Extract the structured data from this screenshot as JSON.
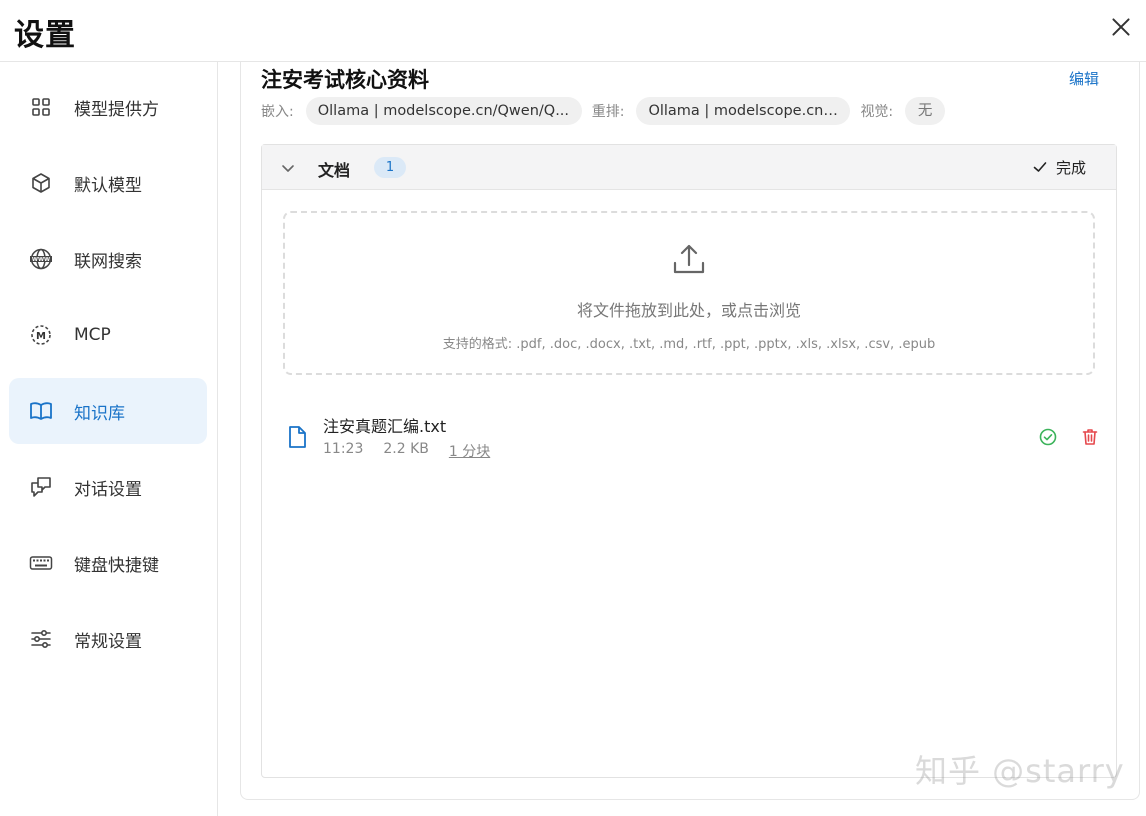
{
  "header": {
    "title": "设置"
  },
  "sidebar": {
    "items": [
      {
        "label": "模型提供方",
        "icon": "grid-icon",
        "active": false
      },
      {
        "label": "默认模型",
        "icon": "cube-icon",
        "active": false
      },
      {
        "label": "联网搜索",
        "icon": "globe-www-icon",
        "active": false
      },
      {
        "label": "MCP",
        "icon": "mcp-icon",
        "active": false
      },
      {
        "label": "知识库",
        "icon": "book-icon",
        "active": true
      },
      {
        "label": "对话设置",
        "icon": "chat-icon",
        "active": false
      },
      {
        "label": "键盘快捷键",
        "icon": "keyboard-icon",
        "active": false
      },
      {
        "label": "常规设置",
        "icon": "sliders-icon",
        "active": false
      }
    ]
  },
  "knowledge_base": {
    "title": "注安考试核心资料",
    "edit_label": "编辑",
    "embed_label": "嵌入:",
    "embed_value": "Ollama | modelscope.cn/Qwen/Q...",
    "rerank_label": "重排:",
    "rerank_value": "Ollama | modelscope.cn/...",
    "vision_label": "视觉:",
    "vision_value": "无"
  },
  "documents": {
    "title": "文档",
    "count": "1",
    "done_label": "完成",
    "dropzone_main": "将文件拖放到此处，或点击浏览",
    "dropzone_sub": "支持的格式: .pdf, .doc, .docx, .txt, .md, .rtf, .ppt, .pptx, .xls, .xlsx, .csv, .epub",
    "files": [
      {
        "name": "注安真题汇编.txt",
        "time": "11:23",
        "size": "2.2 KB",
        "chunks": "1 分块"
      }
    ]
  },
  "watermark": "知乎 @starry",
  "colors": {
    "accent": "#1a73c8",
    "active_bg": "#eaf3fc",
    "success": "#3bb35a",
    "danger": "#e5484d"
  }
}
